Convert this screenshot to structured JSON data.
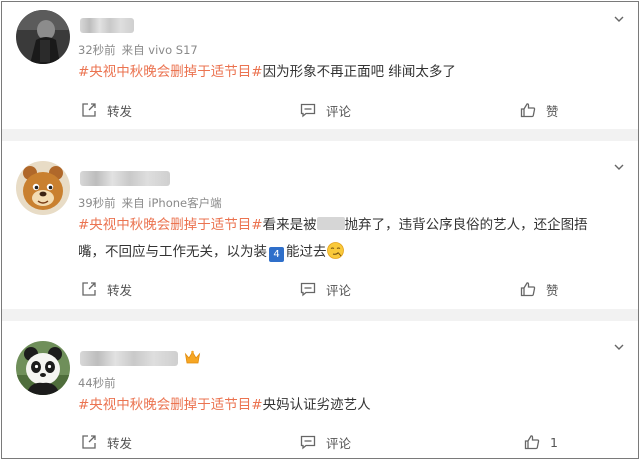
{
  "colors": {
    "tag": "#eb7350",
    "meta": "#8a8a8a",
    "separator": "#f2f2f2"
  },
  "comments": [
    {
      "time": "32秒前",
      "source": "来自 vivo S17",
      "hashtag": "#央视中秋晚会删掉于适节目#",
      "text": "因为形象不再正面吧 绯闻太多了",
      "actions": {
        "repost": "转发",
        "comment": "评论",
        "like": "赞"
      }
    },
    {
      "time": "39秒前",
      "source": "来自 iPhone客户端",
      "hashtag": "#央视中秋晚会删掉于适节目#",
      "text_a": "看来是被",
      "text_b": "抛弃了，违背公序良俗的艺人，还企图捂",
      "text_c": "嘴，不回应与工作无关，以为装",
      "badge_num": "4",
      "text_d": "能过去",
      "actions": {
        "repost": "转发",
        "comment": "评论",
        "like": "赞"
      }
    },
    {
      "time": "44秒前",
      "hashtag": "#央视中秋晚会删掉于适节目#",
      "text": "央妈认证劣迹艺人",
      "actions": {
        "repost": "转发",
        "comment": "评论",
        "like": "1"
      }
    }
  ]
}
